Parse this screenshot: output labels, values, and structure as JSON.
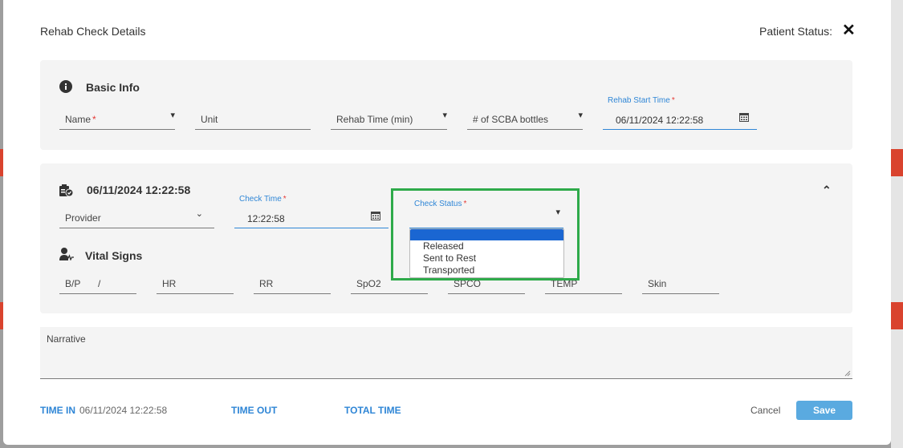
{
  "dialog": {
    "title": "Rehab Check Details",
    "patient_status_label": "Patient Status:",
    "close_icon": "close-icon"
  },
  "basic_info": {
    "title": "Basic Info",
    "name_label": "Name",
    "unit_label": "Unit",
    "rehab_time_label": "Rehab Time (min)",
    "scba_label": "# of SCBA bottles",
    "rehab_start_label": "Rehab Start Time",
    "rehab_start_value": "06/11/2024 12:22:58",
    "required_mark": "*"
  },
  "check": {
    "header": "06/11/2024 12:22:58",
    "provider_label": "Provider",
    "check_time_label": "Check Time",
    "check_time_value": "12:22:58",
    "check_status_label": "Check Status",
    "status_options": [
      "Released",
      "Sent to Rest",
      "Transported"
    ],
    "vital_signs_title": "Vital Signs",
    "vitals": {
      "bp": "B/P",
      "bp_sep": "/",
      "hr": "HR",
      "rr": "RR",
      "spo2": "SpO2",
      "spco": "SPCO",
      "temp": "TEMP",
      "skin": "Skin"
    }
  },
  "narrative": {
    "label": "Narrative"
  },
  "footer": {
    "time_in_label": "TIME IN",
    "time_in_value": "06/11/2024 12:22:58",
    "time_out_label": "TIME OUT",
    "total_time_label": "TOTAL TIME",
    "cancel_label": "Cancel",
    "save_label": "Save"
  },
  "colors": {
    "accent": "#2f86d6",
    "save": "#5aaae0",
    "highlight": "#2eaa4a",
    "required": "#e53935",
    "selected": "#1a66d2"
  }
}
